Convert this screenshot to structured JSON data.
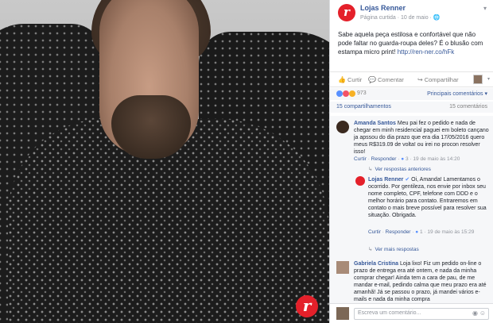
{
  "post": {
    "page_name": "Lojas Renner",
    "meta": "Página curtida · 10 de maio ·",
    "text": "Sabe aquela peça estilosa e confortável que não pode faltar no guarda-roupa deles? É o blusão com estampa micro print!",
    "link": "http://ren-ner.co/hFk",
    "logo_letter": "r"
  },
  "actions": {
    "like": "Curtir",
    "comment": "Comentar",
    "share": "Compartilhar"
  },
  "reactions": {
    "count": "973",
    "sort": "Principais comentários ▾"
  },
  "stats": {
    "shares": "15 compartilhamentos",
    "comments": "15 comentários"
  },
  "comments": {
    "c1": {
      "author": "Amanda Santos",
      "text": "Meu pai fez o pedido e nada de chegar em minh residencial paguei em boleto cançano ja apssou do dia prazo que era dia 17/05/2016 quero meus R$319.09 de volta! ou irei no procon resolver isso!",
      "like": "Curtir",
      "reply": "Responder",
      "reactions": "3",
      "time": "19 de maio às 14:20",
      "more": "Ver respostas anteriores"
    },
    "c2": {
      "author": "Lojas Renner",
      "text": "Oi, Amanda! Lamentamos o ocorrido. Por gentileza, nos envie por inbox seu nome completo, CPF, telefone com DDD e o melhor horário para contato. Entraremos em contato o mais breve possível para resolver sua situação. Obrigada.",
      "like": "Curtir",
      "reply": "Responder",
      "reactions": "1",
      "time": "19 de maio às 15:29",
      "more": "Ver mais respostas"
    },
    "c3": {
      "author": "Gabriela Cristina",
      "text": "Loja lixo! Fiz um pedido on-line o prazo de entrega era até ontem, e nada da minha comprar chegar! Ainda tem a cara de pau, de me mandar e-mail, pedindo calma que meu prazo era até amanhã! Já se passou o prazo, já mandei vários e-mails e nada da minha compra"
    }
  },
  "composer": {
    "placeholder": "Escreva um comentário..."
  },
  "colors": {
    "brand_red": "#e4202a",
    "link_blue": "#365899"
  }
}
